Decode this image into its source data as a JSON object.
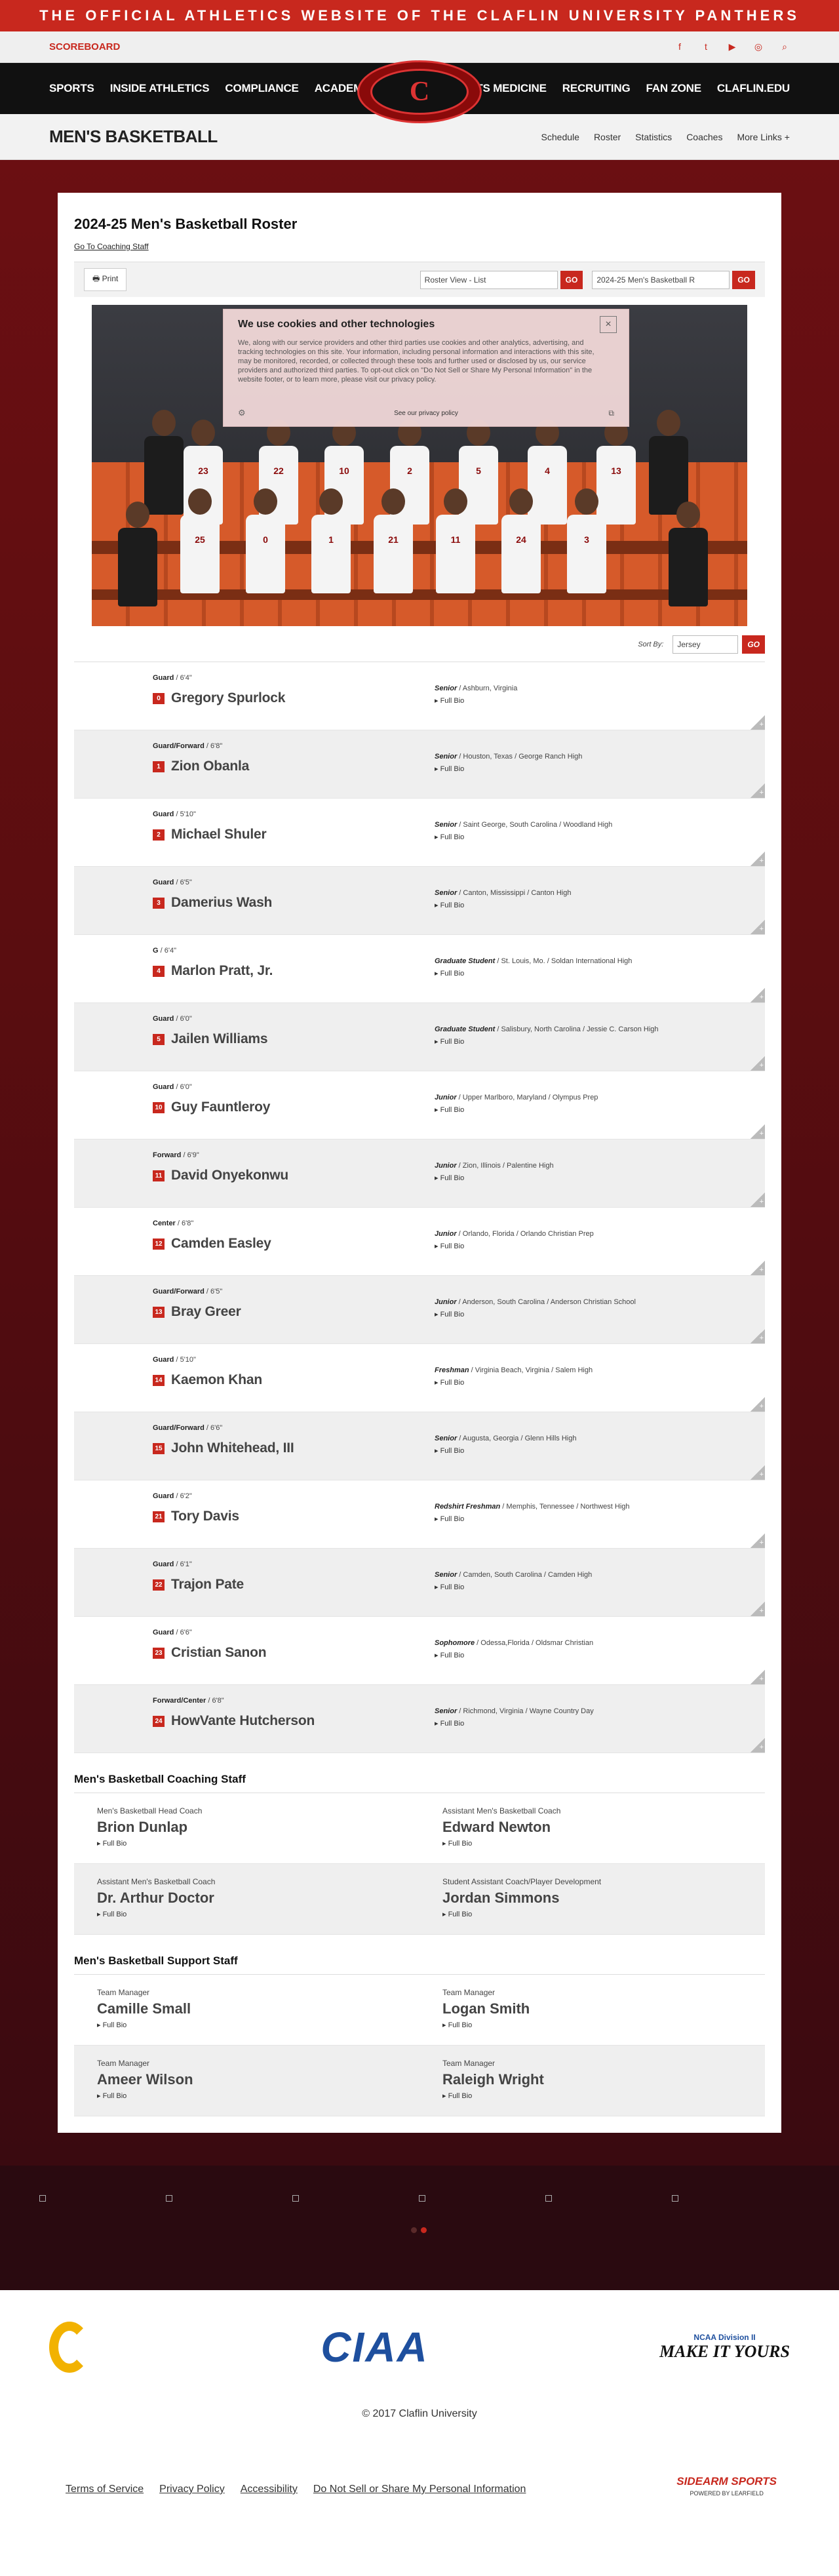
{
  "banner": "The Official Athletics Website of the Claflin University Panthers",
  "scoreboard": "SCOREBOARD",
  "social_icons": [
    "facebook-icon",
    "twitter-icon",
    "youtube-icon",
    "instagram-icon",
    "search-icon"
  ],
  "nav_left": [
    "SPORTS",
    "INSIDE ATHLETICS",
    "COMPLIANCE",
    "ACADEMICS"
  ],
  "nav_right": [
    "SPORTS MEDICINE",
    "RECRUITING",
    "FAN ZONE",
    "CLAFLIN.EDU"
  ],
  "logo_letter": "C",
  "sport": {
    "title": "MEN'S BASKETBALL",
    "links": [
      "Schedule",
      "Roster",
      "Statistics",
      "Coaches",
      "More Links +"
    ]
  },
  "roster_page": {
    "title": "2024-25 Men's Basketball Roster",
    "coach_link": "Go To Coaching Staff",
    "print": "Print",
    "view_select": "Roster View - List",
    "season_select": "2024-25 Men's Basketball R",
    "go": "GO",
    "sort_label": "Sort By:",
    "sort_select": "Jersey"
  },
  "cookie": {
    "title": "We use cookies and other technologies",
    "body": "We, along with our service providers and other third parties use cookies and other analytics, advertising, and tracking technologies on this site. Your information, including personal information and interactions with this site, may be monitored, recorded, or collected through these tools and further used or disclosed by us, our service providers and authorized third parties. To opt-out click on \"Do Not Sell or Share My Personal Information\" in the website footer, or to learn more, please visit our privacy policy.",
    "privacy_link": "See our privacy policy",
    "close": "×"
  },
  "photo_jerseys": [
    "23",
    "22",
    "10",
    "2",
    "5",
    "4",
    "13",
    "25",
    "0",
    "1",
    "21",
    "11",
    "24",
    "3"
  ],
  "full_bio": "Full Bio",
  "players": [
    {
      "num": "0",
      "name": "Gregory Spurlock",
      "pos": "Guard",
      "ht": "6'4\"",
      "class": "Senior",
      "home": "Ashburn, Virginia"
    },
    {
      "num": "1",
      "name": "Zion Obanla",
      "pos": "Guard/Forward",
      "ht": "6'8\"",
      "class": "Senior",
      "home": "Houston, Texas / George Ranch High"
    },
    {
      "num": "2",
      "name": "Michael Shuler",
      "pos": "Guard",
      "ht": "5'10\"",
      "class": "Senior",
      "home": "Saint George, South Carolina / Woodland High"
    },
    {
      "num": "3",
      "name": "Damerius Wash",
      "pos": "Guard",
      "ht": "6'5\"",
      "class": "Senior",
      "home": "Canton, Mississippi / Canton High"
    },
    {
      "num": "4",
      "name": "Marlon Pratt, Jr.",
      "pos": "G",
      "ht": "6'4\"",
      "class": "Graduate Student",
      "home": "St. Louis, Mo. / Soldan International High"
    },
    {
      "num": "5",
      "name": "Jailen Williams",
      "pos": "Guard",
      "ht": "6'0\"",
      "class": "Graduate Student",
      "home": "Salisbury, North Carolina / Jessie C. Carson High"
    },
    {
      "num": "10",
      "name": "Guy Fauntleroy",
      "pos": "Guard",
      "ht": "6'0\"",
      "class": "Junior",
      "home": "Upper Marlboro, Maryland / Olympus Prep"
    },
    {
      "num": "11",
      "name": "David Onyekonwu",
      "pos": "Forward",
      "ht": "6'9\"",
      "class": "Junior",
      "home": "Zion, Illinois / Palentine High"
    },
    {
      "num": "12",
      "name": "Camden Easley",
      "pos": "Center",
      "ht": "6'8\"",
      "class": "Junior",
      "home": "Orlando, Florida / Orlando Christian Prep"
    },
    {
      "num": "13",
      "name": "Bray Greer",
      "pos": "Guard/Forward",
      "ht": "6'5\"",
      "class": "Junior",
      "home": "Anderson, South Carolina / Anderson Christian School"
    },
    {
      "num": "14",
      "name": "Kaemon Khan",
      "pos": "Guard",
      "ht": "5'10\"",
      "class": "Freshman",
      "home": "Virginia Beach, Virginia / Salem High"
    },
    {
      "num": "15",
      "name": "John Whitehead, III",
      "pos": "Guard/Forward",
      "ht": "6'6\"",
      "class": "Senior",
      "home": "Augusta, Georgia / Glenn Hills High"
    },
    {
      "num": "21",
      "name": "Tory Davis",
      "pos": "Guard",
      "ht": "6'2\"",
      "class": "Redshirt Freshman",
      "home": "Memphis, Tennessee / Northwest High"
    },
    {
      "num": "22",
      "name": "Trajon Pate",
      "pos": "Guard",
      "ht": "6'1\"",
      "class": "Senior",
      "home": "Camden, South Carolina / Camden High"
    },
    {
      "num": "23",
      "name": "Cristian Sanon",
      "pos": "Guard",
      "ht": "6'6\"",
      "class": "Sophomore",
      "home": "Odessa,Florida / Oldsmar Christian"
    },
    {
      "num": "24",
      "name": "HowVante Hutcherson",
      "pos": "Forward/Center",
      "ht": "6'8\"",
      "class": "Senior",
      "home": "Richmond, Virginia / Wayne Country Day"
    }
  ],
  "coaching": {
    "title": "Men's Basketball Coaching Staff",
    "staff": [
      {
        "title": "Men's Basketball Head Coach",
        "name": "Brion Dunlap"
      },
      {
        "title": "Assistant Men's Basketball Coach",
        "name": "Edward Newton"
      },
      {
        "title": "Assistant Men's Basketball Coach",
        "name": "Dr. Arthur Doctor"
      },
      {
        "title": "Student Assistant Coach/Player Development",
        "name": "Jordan Simmons"
      }
    ]
  },
  "support": {
    "title": "Men's Basketball Support Staff",
    "staff": [
      {
        "title": "Team Manager",
        "name": "Camille Small"
      },
      {
        "title": "Team Manager",
        "name": "Logan Smith"
      },
      {
        "title": "Team Manager",
        "name": "Ameer Wilson"
      },
      {
        "title": "Team Manager",
        "name": "Raleigh Wright"
      }
    ]
  },
  "footer": {
    "ciaa": "CIAA",
    "ncaa_small": "NCAA Division II",
    "ncaa_big": "MAKE IT YOURS",
    "copyright": "© 2017 Claflin University",
    "links": [
      "Terms of Service",
      "Privacy Policy",
      "Accessibility",
      "Do Not Sell or Share My Personal Information"
    ],
    "sidearm": "SIDEARM SPORTS",
    "sidearm_sub": "POWERED BY LEARFIELD"
  }
}
